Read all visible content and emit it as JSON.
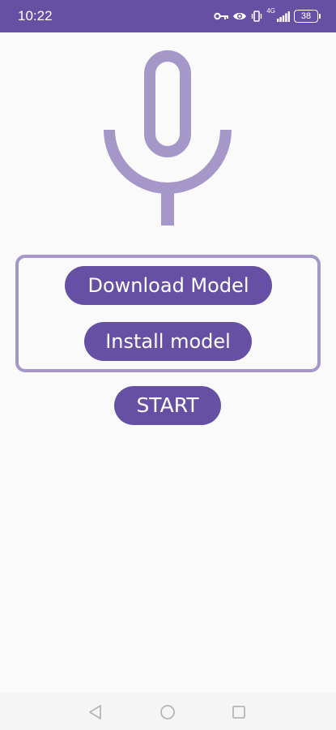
{
  "status_bar": {
    "time": "10:22",
    "network": "4G",
    "battery": "38",
    "icons": [
      "vpn-key-icon",
      "eye-icon",
      "vibrate-icon",
      "signal-icon",
      "battery-icon"
    ]
  },
  "app": {
    "icon": "microphone-icon",
    "buttons": {
      "download": "Download Model",
      "install": "Install model",
      "start": "START"
    }
  },
  "nav": {
    "icons": [
      "back-icon",
      "home-icon",
      "recent-apps-icon"
    ]
  },
  "colors": {
    "primary": "#6650a4",
    "primary_light": "#a597c8",
    "background": "#fafafa"
  }
}
